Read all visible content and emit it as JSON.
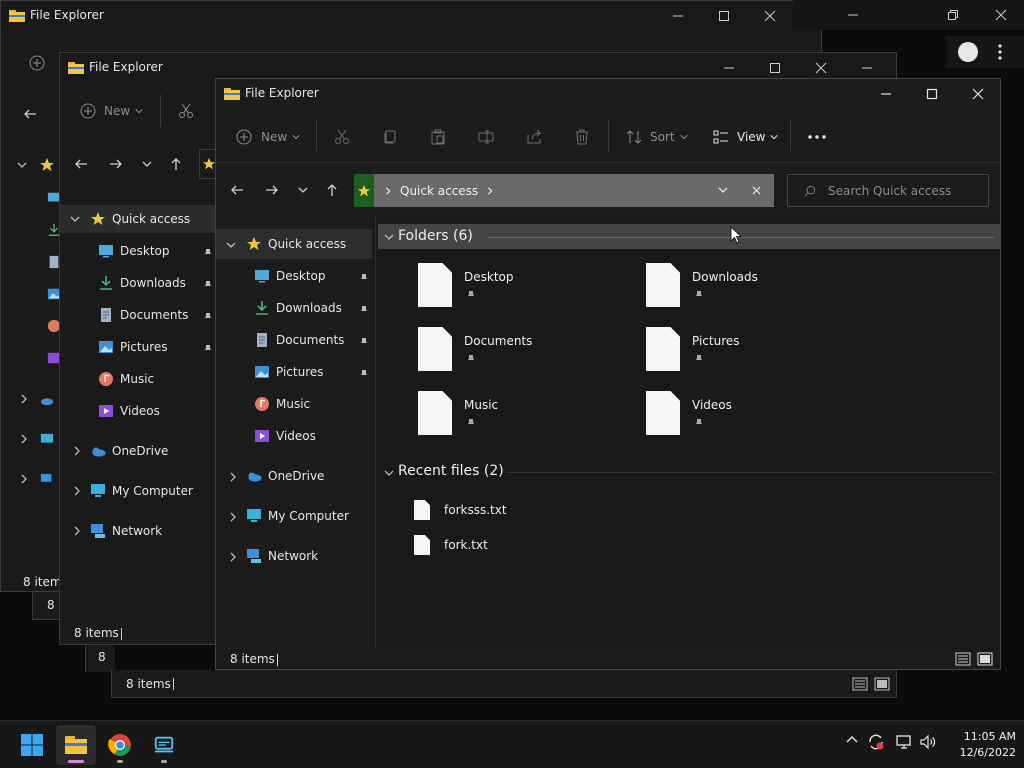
{
  "app_title": "File Explorer",
  "toolbar": {
    "new_label": "New",
    "sort_label": "Sort",
    "view_label": "View"
  },
  "address": {
    "location": "Quick access"
  },
  "search": {
    "placeholder": "Search Quick access"
  },
  "sidebar": {
    "quick_access": "Quick access",
    "items": [
      {
        "label": "Desktop",
        "icon": "desktop-icon",
        "pinned": true
      },
      {
        "label": "Downloads",
        "icon": "download-icon",
        "pinned": true
      },
      {
        "label": "Documents",
        "icon": "documents-icon",
        "pinned": true
      },
      {
        "label": "Pictures",
        "icon": "pictures-icon",
        "pinned": true
      },
      {
        "label": "Music",
        "icon": "music-icon",
        "pinned": false
      },
      {
        "label": "Videos",
        "icon": "videos-icon",
        "pinned": false
      }
    ],
    "onedrive": "OneDrive",
    "my_computer": "My Computer",
    "network": "Network"
  },
  "main": {
    "folders_header": "Folders (6)",
    "folders": [
      {
        "label": "Desktop"
      },
      {
        "label": "Downloads"
      },
      {
        "label": "Documents"
      },
      {
        "label": "Pictures"
      },
      {
        "label": "Music"
      },
      {
        "label": "Videos"
      }
    ],
    "recent_header": "Recent files (2)",
    "recent_files": [
      {
        "label": "forksss.txt"
      },
      {
        "label": "fork.txt"
      }
    ]
  },
  "status": {
    "items": "8 items",
    "items_a": "8 items",
    "items_b": "8 items",
    "items_c": "8 items",
    "trunc_a": "8 i",
    "trunc_b": "8"
  },
  "taskbar": {
    "time": "11:05 AM",
    "date": "12/6/2022"
  },
  "colors": {
    "address_bg": "#6a6a6a",
    "star_bg": "#1f5c21",
    "accent_indicator": "#d88ad6"
  }
}
